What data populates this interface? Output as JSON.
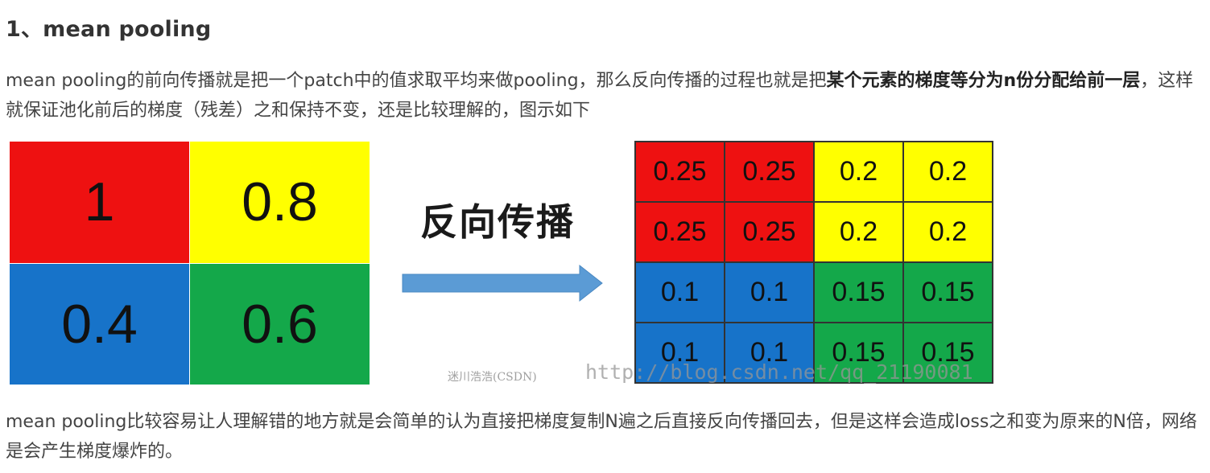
{
  "heading": "1、mean pooling",
  "paragraph1": {
    "before": "mean pooling的前向传播就是把一个patch中的值求取平均来做pooling，那么反向传播的过程也就是把",
    "bold": "某个元素的梯度等分为n份分配给前一层",
    "after": "，这样就保证池化前后的梯度（残差）之和保持不变，还是比较理解的，图示如下"
  },
  "figure": {
    "left_grid": [
      {
        "value": "1",
        "color": "red"
      },
      {
        "value": "0.8",
        "color": "yellow"
      },
      {
        "value": "0.4",
        "color": "blue"
      },
      {
        "value": "0.6",
        "color": "green"
      }
    ],
    "label": "反向传播",
    "right_grid": [
      {
        "value": "0.25",
        "color": "red"
      },
      {
        "value": "0.25",
        "color": "red"
      },
      {
        "value": "0.2",
        "color": "yellow"
      },
      {
        "value": "0.2",
        "color": "yellow"
      },
      {
        "value": "0.25",
        "color": "red"
      },
      {
        "value": "0.25",
        "color": "red"
      },
      {
        "value": "0.2",
        "color": "yellow"
      },
      {
        "value": "0.2",
        "color": "yellow"
      },
      {
        "value": "0.1",
        "color": "blue"
      },
      {
        "value": "0.1",
        "color": "blue"
      },
      {
        "value": "0.15",
        "color": "green"
      },
      {
        "value": "0.15",
        "color": "green"
      },
      {
        "value": "0.1",
        "color": "blue"
      },
      {
        "value": "0.1",
        "color": "blue"
      },
      {
        "value": "0.15",
        "color": "green"
      },
      {
        "value": "0.15",
        "color": "green"
      }
    ],
    "arrow_color": "#5b9bd5",
    "watermark_cn": "迷川浩浩(CSDN)",
    "watermark_url": "http://blog.csdn.net/qq_21190081"
  },
  "paragraph2": "mean pooling比较容易让人理解错的地方就是会简单的认为直接把梯度复制N遍之后直接反向传播回去，但是这样会造成loss之和变为原来的N倍，网络是会产生梯度爆炸的。"
}
